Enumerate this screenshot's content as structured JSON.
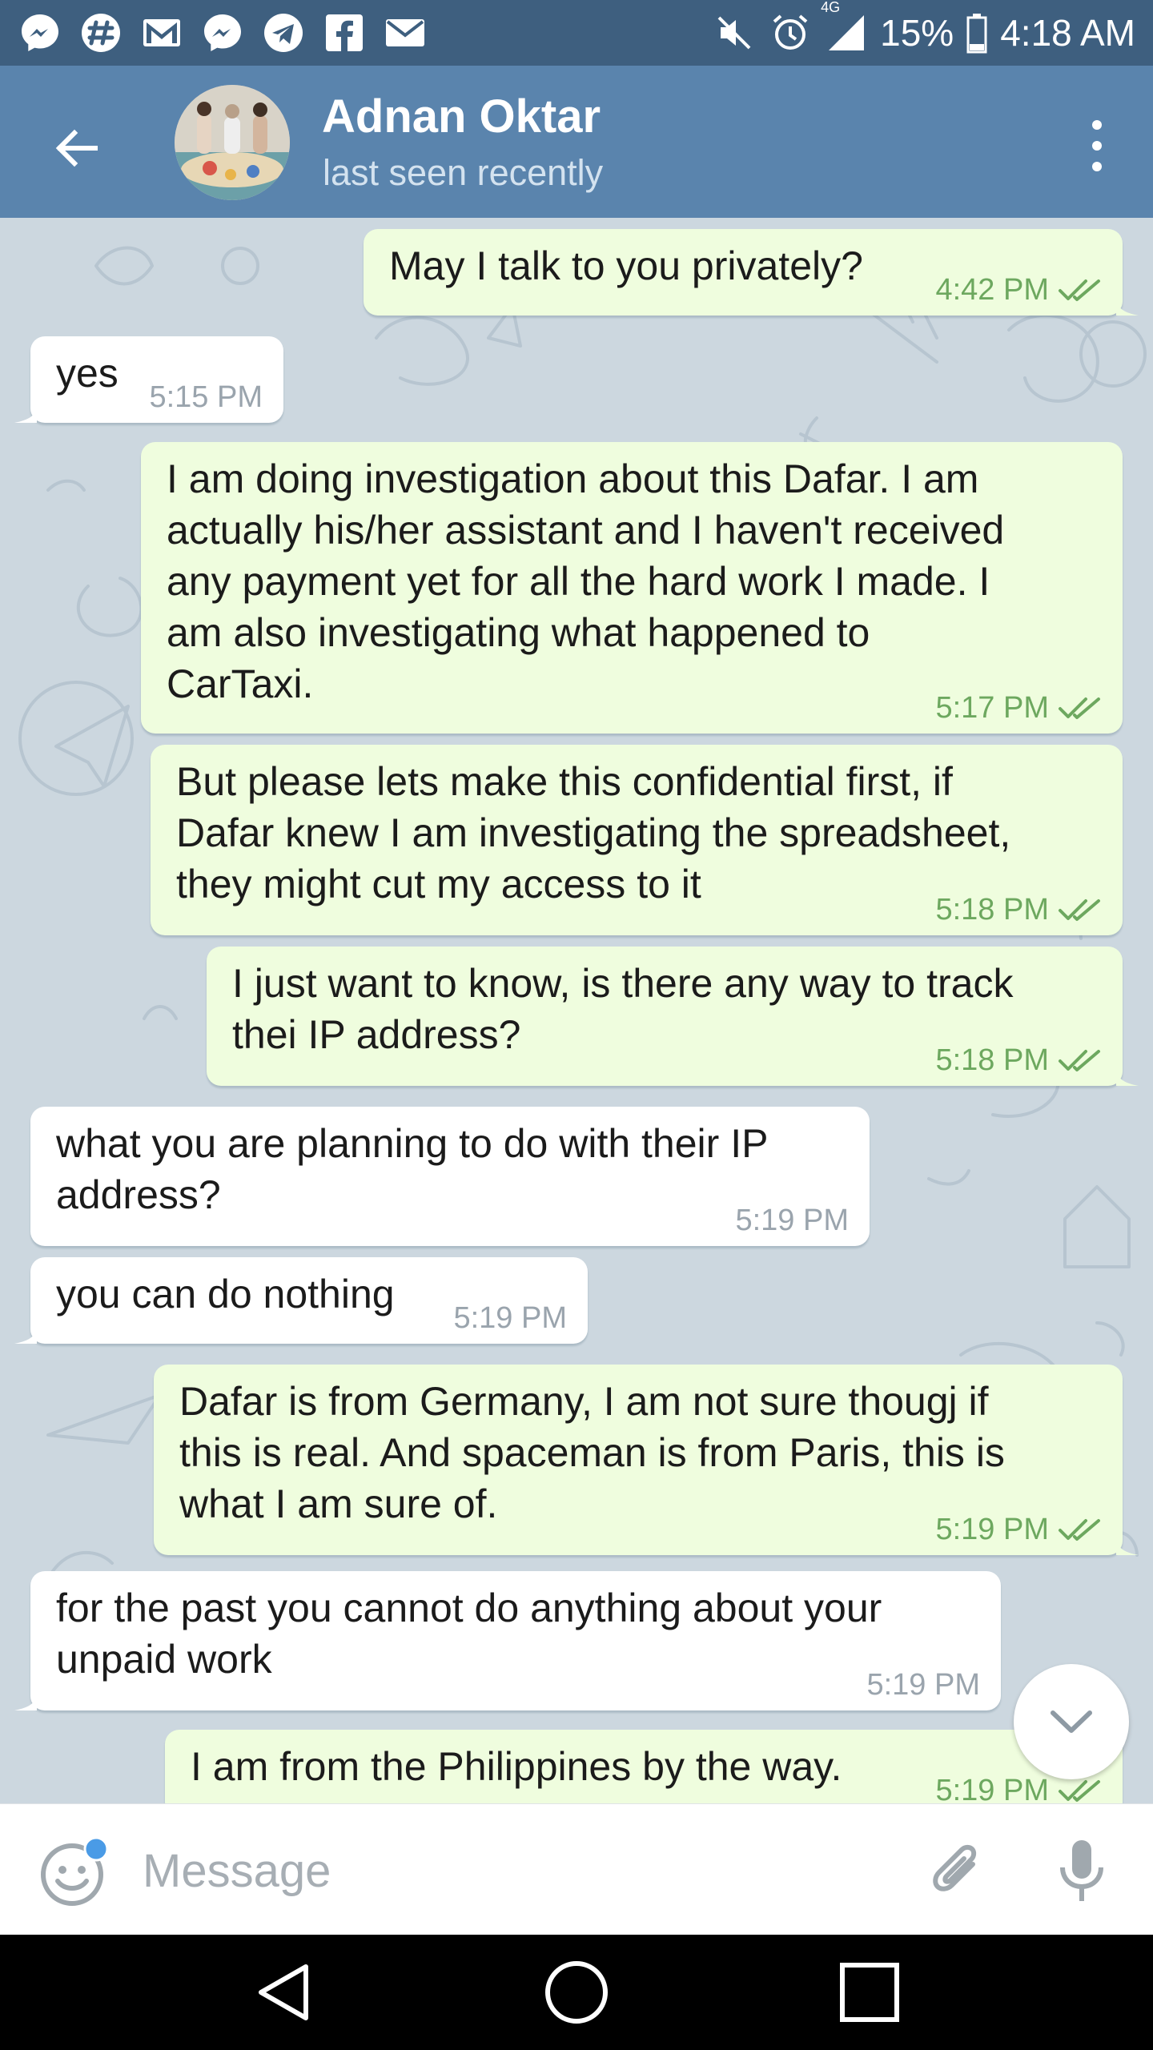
{
  "status_bar": {
    "battery": "15%",
    "time": "4:18 AM",
    "network": "4G",
    "notification_icons": [
      "messenger-icon",
      "slack-icon",
      "gmail-icon",
      "messenger-icon",
      "telegram-icon",
      "facebook-icon",
      "mail-icon"
    ],
    "system_icons": [
      "mute-icon",
      "alarm-icon",
      "signal-icon",
      "battery-icon"
    ]
  },
  "header": {
    "title": "Adnan Oktar",
    "subtitle": "last seen recently",
    "back_icon": "arrow-left-icon",
    "menu_icon": "more-vertical-icon"
  },
  "messages": [
    {
      "dir": "out",
      "text": "May I talk to you privately?",
      "time": "4:42 PM",
      "read": true
    },
    {
      "dir": "in",
      "text": "yes",
      "time": "5:15 PM"
    },
    {
      "dir": "out",
      "text": "I am doing investigation about this Dafar. I am\nactually his/her assistant and I haven't received\nany payment yet for all the hard work I made. I\nam also investigating what happened to\nCarTaxi.",
      "time": "5:17 PM",
      "read": true
    },
    {
      "dir": "out",
      "text": "But please lets make this confidential first, if\nDafar knew I am investigating the spreadsheet,\nthey might cut my access to it",
      "time": "5:18 PM",
      "read": true
    },
    {
      "dir": "out",
      "text": "I just want to know, is there any way to track\nthei IP address?",
      "time": "5:18 PM",
      "read": true
    },
    {
      "dir": "in",
      "text": "what you are planning to do with their IP\naddress?",
      "time": "5:19 PM"
    },
    {
      "dir": "in",
      "text": "you can do nothing",
      "time": "5:19 PM"
    },
    {
      "dir": "out",
      "text": "Dafar is from Germany, I am not sure thougj if\nthis is real. And spaceman is from Paris, this is\nwhat I am sure of.",
      "time": "5:19 PM",
      "read": true
    },
    {
      "dir": "in",
      "text": "for the past you cannot do anything about your\nunpaid work",
      "time": "5:19 PM"
    },
    {
      "dir": "out",
      "text": "I am from the Philippines by the way.",
      "time": "5:19 PM",
      "read": true
    }
  ],
  "input": {
    "placeholder": "Message",
    "value": ""
  },
  "colors": {
    "status_bar": "#3e5f7f",
    "header": "#5a84ad",
    "chat_background": "#ccd7df",
    "outgoing_bubble": "#effdde",
    "incoming_bubble": "#ffffff",
    "outgoing_meta": "#6da85f",
    "incoming_meta": "#9aa4ad",
    "emoji_badge": "#4a9be6"
  }
}
